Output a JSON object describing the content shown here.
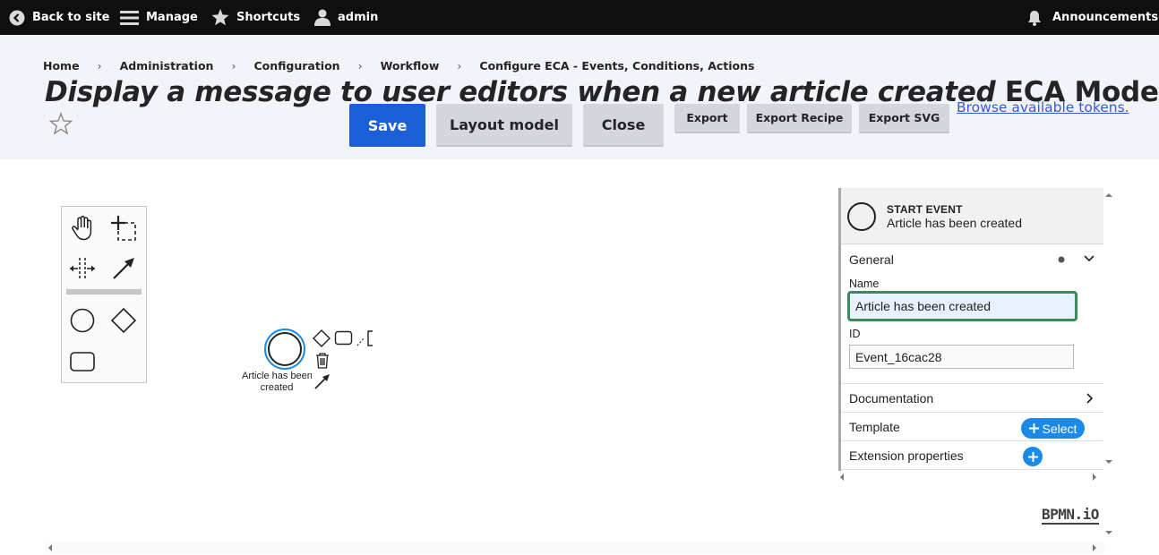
{
  "toolbar": {
    "back": "Back to site",
    "manage": "Manage",
    "shortcuts": "Shortcuts",
    "user": "admin",
    "announcements": "Announcements"
  },
  "breadcrumb": [
    "Home",
    "Administration",
    "Configuration",
    "Workflow",
    "Configure ECA - Events, Conditions, Actions"
  ],
  "title": {
    "italic": "Display a message to user editors when a new article created",
    "suffix": " ECA Model"
  },
  "buttons": {
    "save": "Save",
    "layout": "Layout model",
    "close": "Close",
    "export": "Export",
    "export_recipe": "Export Recipe",
    "export_svg": "Export SVG"
  },
  "tokens_link": "Browse available tokens.",
  "canvas": {
    "event_label_line1": "Article has been",
    "event_label_line2": "created"
  },
  "properties": {
    "element_type": "START EVENT",
    "element_name": "Article has been created",
    "group_general": "General",
    "name_label": "Name",
    "name_value": "Article has been created",
    "id_label": "ID",
    "id_value": "Event_16cac28",
    "documentation": "Documentation",
    "template": "Template",
    "select_label": "Select",
    "extension_properties": "Extension properties"
  },
  "logo": "BPMN.iO",
  "colors": {
    "toolbar_bg": "#0f0f0f",
    "header_bg": "#f3f4f9",
    "primary": "#1b5fd6",
    "link": "#2f5fcf",
    "selection": "#1a8ae6",
    "active_field_border": "#3a8a5c"
  }
}
